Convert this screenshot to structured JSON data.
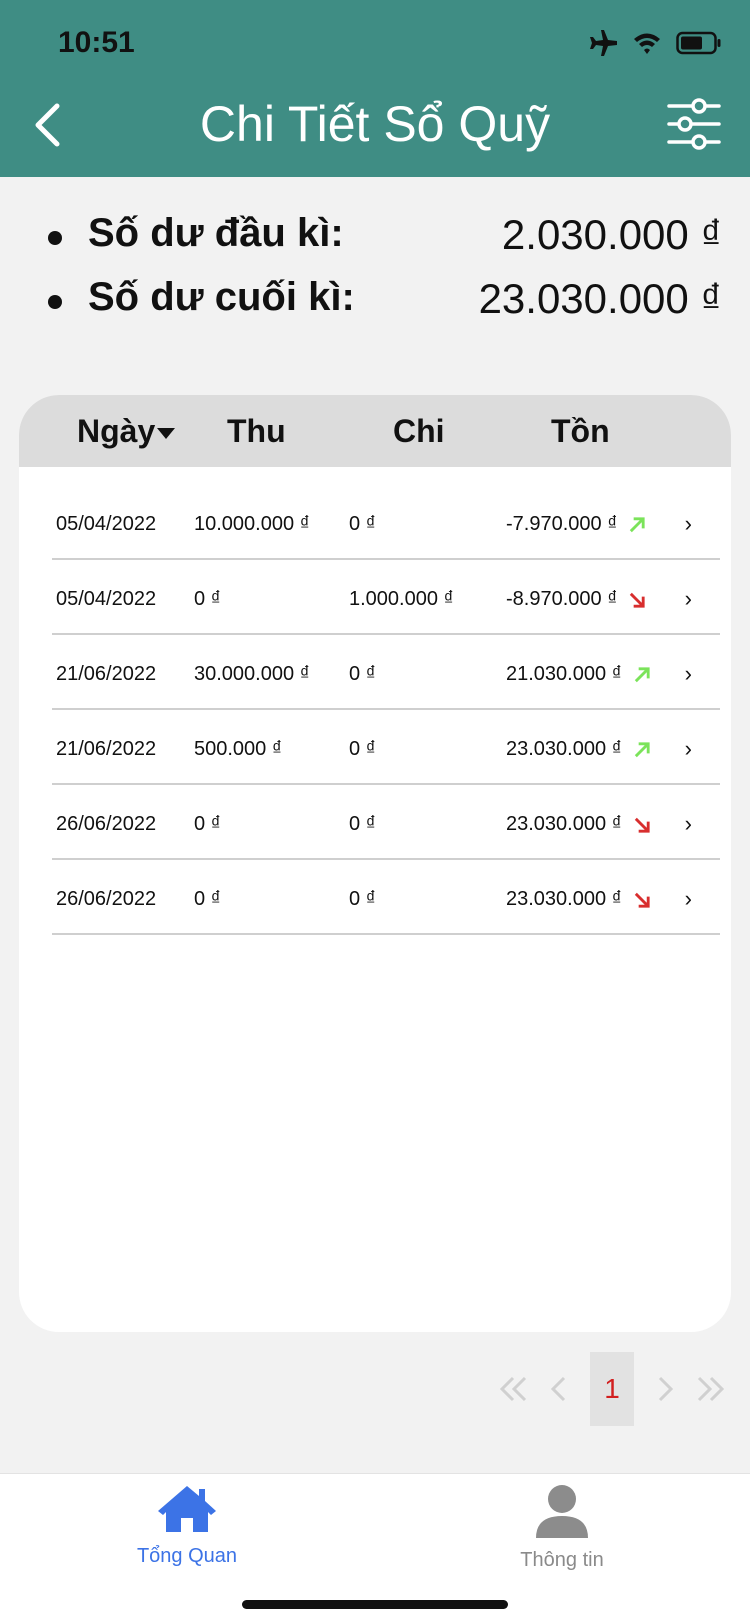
{
  "status_bar": {
    "time": "10:51"
  },
  "header": {
    "title": "Chi Tiết Sổ Quỹ"
  },
  "balances": [
    {
      "label": "Số dư đầu kì:",
      "value": "2.030.000 ₫"
    },
    {
      "label": "Số dư cuối kì:",
      "value": "23.030.000 ₫"
    }
  ],
  "table": {
    "columns": [
      "Ngày",
      "Thu",
      "Chi",
      "Tồn"
    ],
    "rows": [
      {
        "date": "05/04/2022",
        "thu": "10.000.000 ₫",
        "chi": "0 ₫",
        "ton": "-7.970.000 ₫",
        "trend": "up"
      },
      {
        "date": "05/04/2022",
        "thu": "0 ₫",
        "chi": "1.000.000 ₫",
        "ton": "-8.970.000 ₫",
        "trend": "down"
      },
      {
        "date": "21/06/2022",
        "thu": "30.000.000 ₫",
        "chi": "0 ₫",
        "ton": "21.030.000 ₫",
        "trend": "up"
      },
      {
        "date": "21/06/2022",
        "thu": "500.000 ₫",
        "chi": "0 ₫",
        "ton": "23.030.000 ₫",
        "trend": "up"
      },
      {
        "date": "26/06/2022",
        "thu": "0 ₫",
        "chi": "0 ₫",
        "ton": "23.030.000 ₫",
        "trend": "down"
      },
      {
        "date": "26/06/2022",
        "thu": "0 ₫",
        "chi": "0 ₫",
        "ton": "23.030.000 ₫",
        "trend": "down"
      }
    ]
  },
  "pagination": {
    "current": "1"
  },
  "tabs": {
    "overview": "Tổng Quan",
    "info": "Thông tin"
  },
  "colors": {
    "header": "#3f8d84",
    "up": "#7be35a",
    "down": "#d82e2e",
    "active_tab": "#3c73e6",
    "active_page": "#d21f1f"
  },
  "icons": {
    "back": "chevron-left-icon",
    "filter": "sliders-icon",
    "home": "home-icon",
    "user": "user-icon"
  }
}
